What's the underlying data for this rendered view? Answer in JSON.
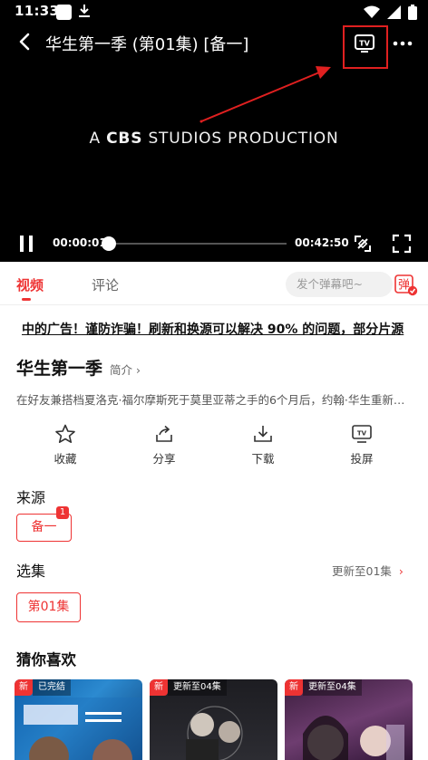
{
  "status_bar": {
    "time": "11:33"
  },
  "player": {
    "title": "华生第一季 (第01集) [备一]",
    "production_prefix": "A",
    "production_brand": "CBS",
    "production_suffix": "STUDIOS PRODUCTION",
    "current_time": "00:00:01",
    "total_time": "00:42:50",
    "progress": 0.0004
  },
  "tabs": {
    "video": "视频",
    "comment": "评论"
  },
  "danmaku": {
    "placeholder": "发个弹幕吧~",
    "button": "弹"
  },
  "marquee": "中的广告！谨防诈骗！刷新和换源可以解决 90% 的问题，部分片源",
  "show": {
    "title": "华生第一季",
    "intro": "简介",
    "synopsis": "在好友兼搭档夏洛克·福尔摩斯死于莫里亚蒂之手的6个月后，约翰·华生重新开了一家诊所…"
  },
  "actions": {
    "favorite": "收藏",
    "share": "分享",
    "download": "下载",
    "cast": "投屏"
  },
  "source": {
    "title": "来源",
    "item": "备一",
    "badge": "1"
  },
  "episodes": {
    "title": "选集",
    "update": "更新至01集",
    "item": "第01集"
  },
  "recommend": {
    "title": "猜你喜欢",
    "items": [
      {
        "new": "新",
        "status": "已完结"
      },
      {
        "new": "新",
        "status": "更新至04集"
      },
      {
        "new": "新",
        "status": "更新至04集"
      }
    ]
  },
  "colors": {
    "accent": "#e33333",
    "annotation": "#e02020"
  }
}
